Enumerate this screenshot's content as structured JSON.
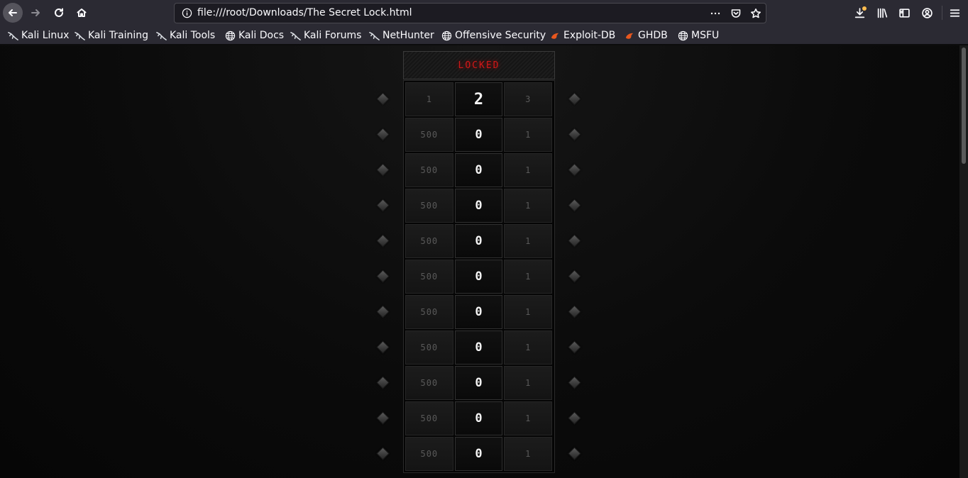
{
  "browser": {
    "url": "file:///root/Downloads/The Secret Lock.html",
    "bookmarks": [
      {
        "label": "Kali Linux",
        "icon": "kali-dragon-icon"
      },
      {
        "label": "Kali Training",
        "icon": "kali-dragon-icon"
      },
      {
        "label": "Kali Tools",
        "icon": "kali-dragon-icon"
      },
      {
        "label": "Kali Docs",
        "icon": "globe-icon"
      },
      {
        "label": "Kali Forums",
        "icon": "kali-dragon-icon"
      },
      {
        "label": "NetHunter",
        "icon": "kali-dragon-icon"
      },
      {
        "label": "Offensive Security",
        "icon": "globe-icon"
      },
      {
        "label": "Exploit-DB",
        "icon": "exploit-db-icon"
      },
      {
        "label": "GHDB",
        "icon": "exploit-db-icon"
      },
      {
        "label": "MSFU",
        "icon": "globe-icon"
      }
    ],
    "colors": {
      "toolbar": "#2b2a33",
      "accent_dot": "#ffbd4f"
    }
  },
  "lock": {
    "status": "LOCKED",
    "status_color": "#d11818",
    "rows": [
      [
        "1",
        "2",
        "3"
      ],
      [
        "500",
        "0",
        "1"
      ],
      [
        "500",
        "0",
        "1"
      ],
      [
        "500",
        "0",
        "1"
      ],
      [
        "500",
        "0",
        "1"
      ],
      [
        "500",
        "0",
        "1"
      ],
      [
        "500",
        "0",
        "1"
      ],
      [
        "500",
        "0",
        "1"
      ],
      [
        "500",
        "0",
        "1"
      ],
      [
        "500",
        "0",
        "1"
      ],
      [
        "500",
        "0",
        "1"
      ]
    ]
  }
}
